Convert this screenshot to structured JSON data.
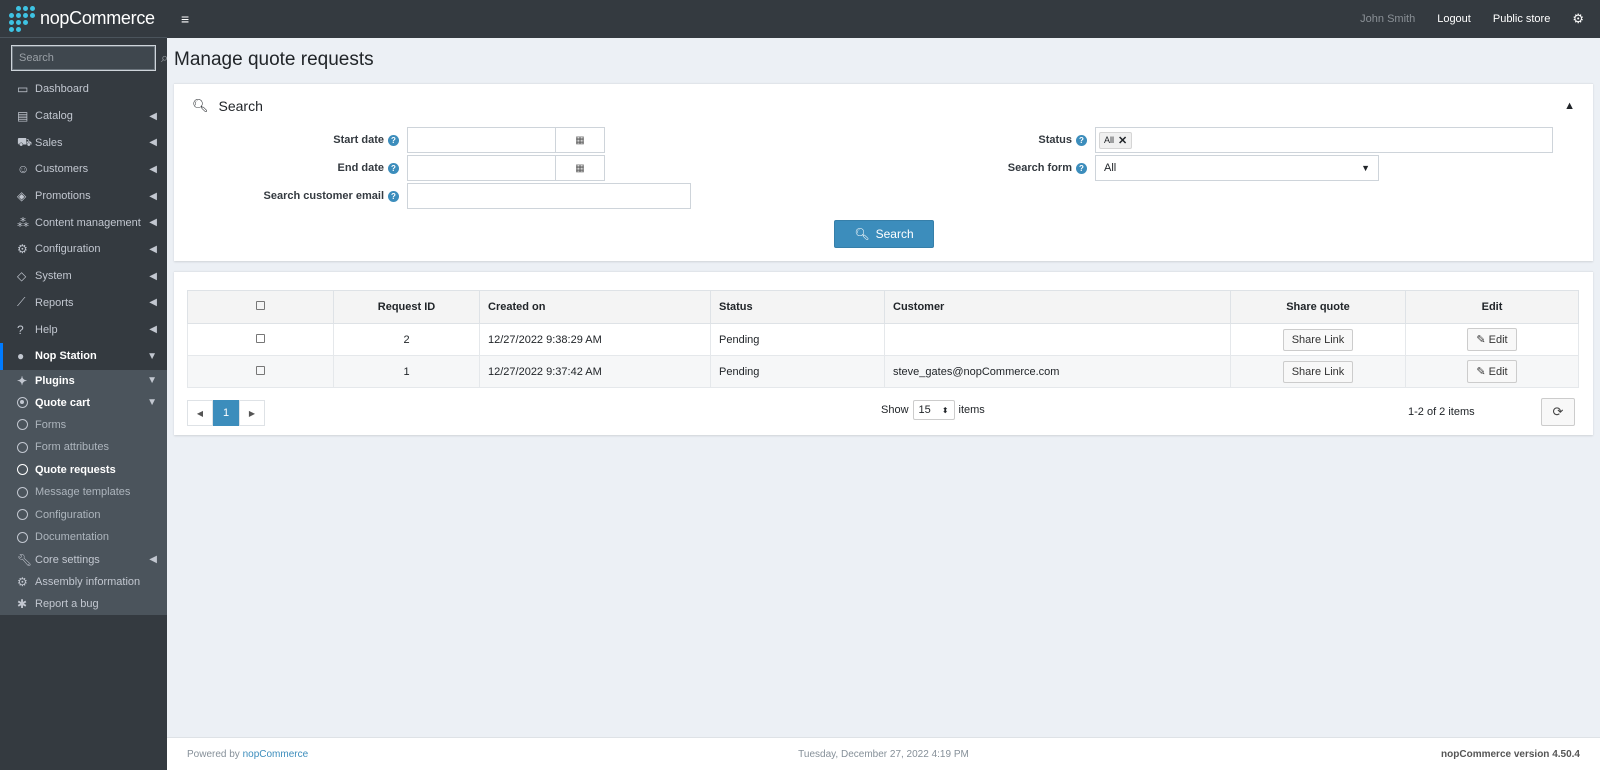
{
  "app": {
    "brand": "nopCommerce",
    "accent_color": "#3c8dbc",
    "sidebar_bg": "#343a40"
  },
  "sidebar": {
    "search_placeholder": "Search",
    "items": [
      {
        "label": "Dashboard",
        "icon": "monitor-icon"
      },
      {
        "label": "Catalog",
        "icon": "book-icon"
      },
      {
        "label": "Sales",
        "icon": "cart-icon"
      },
      {
        "label": "Customers",
        "icon": "user-icon"
      },
      {
        "label": "Promotions",
        "icon": "tags-icon"
      },
      {
        "label": "Content management",
        "icon": "cubes-icon"
      },
      {
        "label": "Configuration",
        "icon": "gears-icon"
      },
      {
        "label": "System",
        "icon": "cube-icon"
      },
      {
        "label": "Reports",
        "icon": "line-chart-icon"
      },
      {
        "label": "Help",
        "icon": "question-circle-icon"
      },
      {
        "label": "Nop Station",
        "icon": "circle-icon"
      }
    ],
    "plugins_label": "Plugins",
    "quote_cart_label": "Quote cart",
    "quote_cart_children": [
      "Forms",
      "Form attributes",
      "Quote requests",
      "Message templates",
      "Configuration",
      "Documentation"
    ],
    "tail_items": [
      {
        "label": "Core settings",
        "icon": "wrench-icon"
      },
      {
        "label": "Assembly information",
        "icon": "gear-icon"
      },
      {
        "label": "Report a bug",
        "icon": "bug-icon"
      }
    ]
  },
  "topbar": {
    "user": "John Smith",
    "logout": "Logout",
    "public_store": "Public store"
  },
  "page": {
    "title": "Manage quote requests"
  },
  "search": {
    "title": "Search",
    "start_date_label": "Start date",
    "end_date_label": "End date",
    "email_label": "Search customer email",
    "status_label": "Status",
    "status_tag": "All",
    "search_form_label": "Search form",
    "search_form_value": "All",
    "button": "Search"
  },
  "grid": {
    "columns": [
      "Request ID",
      "Created on",
      "Status",
      "Customer",
      "Share quote",
      "Edit"
    ],
    "rows": [
      {
        "id": "2",
        "created": "12/27/2022 9:38:29 AM",
        "status": "Pending",
        "customer": "",
        "share": "Share Link",
        "edit": "Edit"
      },
      {
        "id": "1",
        "created": "12/27/2022 9:37:42 AM",
        "status": "Pending",
        "customer": "steve_gates@nopCommerce.com",
        "share": "Share Link",
        "edit": "Edit"
      }
    ],
    "page": "1",
    "show_label": "Show",
    "page_size": "15",
    "items_label": "items",
    "count_text": "1-2 of 2 items"
  },
  "footer": {
    "powered_by": "Powered by",
    "powered_link": "nopCommerce",
    "date": "Tuesday, December 27, 2022 4:19 PM",
    "version": "nopCommerce version 4.50.4"
  }
}
